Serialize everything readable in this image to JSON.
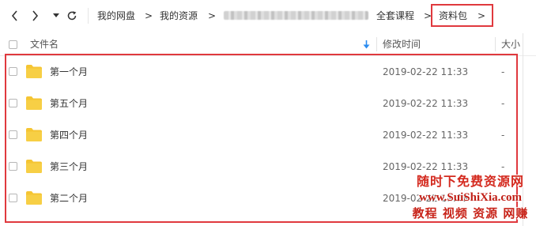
{
  "breadcrumb": {
    "items": [
      "我的网盘",
      "我的资源",
      "全套课程",
      "资料包"
    ],
    "separator": ">",
    "trailing_arrow": ">"
  },
  "columns": {
    "name": "文件名",
    "modified": "修改时间",
    "size": "大小"
  },
  "rows": [
    {
      "name": "第一个月",
      "modified": "2019-02-22 11:33",
      "size": "-"
    },
    {
      "name": "第五个月",
      "modified": "2019-02-22 11:33",
      "size": "-"
    },
    {
      "name": "第四个月",
      "modified": "2019-02-22 11:33",
      "size": "-"
    },
    {
      "name": "第三个月",
      "modified": "2019-02-22 11:33",
      "size": "-"
    },
    {
      "name": "第二个月",
      "modified": "2019-02-22 11:33",
      "size": "-"
    }
  ],
  "watermark": {
    "line1": "随时下免费资源网",
    "line2": "www.SuiShiXia.com",
    "line3": "教程 视频 资源 网赚"
  },
  "colors": {
    "highlight": "#e0393e",
    "folder": "#f5c533",
    "sort_arrow": "#2b8cf0"
  },
  "icons": [
    "back-arrow-icon",
    "forward-arrow-icon",
    "dropdown-caret-icon",
    "refresh-icon",
    "sort-down-icon",
    "folder-icon"
  ]
}
